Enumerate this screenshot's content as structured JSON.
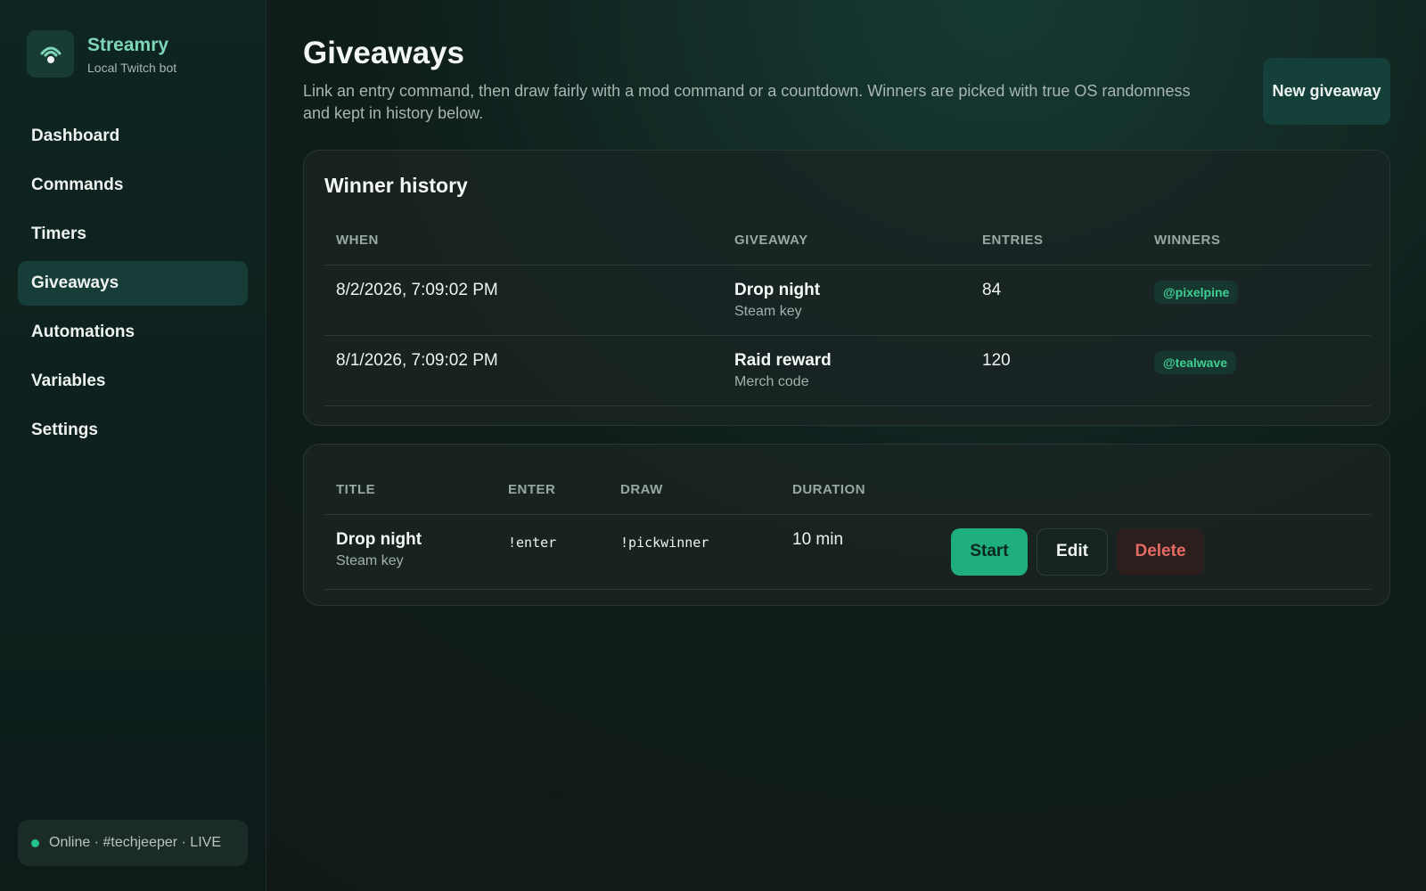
{
  "brand": {
    "name": "Streamry",
    "subtitle": "Local Twitch bot",
    "logo_icon": "broadcast-icon"
  },
  "sidebar": {
    "items": [
      {
        "label": "Dashboard",
        "active": false
      },
      {
        "label": "Commands",
        "active": false
      },
      {
        "label": "Timers",
        "active": false
      },
      {
        "label": "Giveaways",
        "active": true
      },
      {
        "label": "Automations",
        "active": false
      },
      {
        "label": "Variables",
        "active": false
      },
      {
        "label": "Settings",
        "active": false
      }
    ],
    "status": "Online · #techjeeper · LIVE"
  },
  "page": {
    "title": "Giveaways",
    "description": "Link an entry command, then draw fairly with a mod command or a countdown. Winners are picked with true OS randomness and kept in history below.",
    "new_button": "New giveaway"
  },
  "history": {
    "title": "Winner history",
    "columns": [
      "WHEN",
      "GIVEAWAY",
      "ENTRIES",
      "WINNERS"
    ],
    "rows": [
      {
        "when": "8/2/2026, 7:09:02 PM",
        "title": "Drop night",
        "prize": "Steam key",
        "entries": "84",
        "winner": "@pixelpine"
      },
      {
        "when": "8/1/2026, 7:09:02 PM",
        "title": "Raid reward",
        "prize": "Merch code",
        "entries": "120",
        "winner": "@tealwave"
      }
    ]
  },
  "giveaways": {
    "columns": [
      "TITLE",
      "ENTER",
      "DRAW",
      "DURATION"
    ],
    "rows": [
      {
        "title": "Drop night",
        "prize": "Steam key",
        "enter": "!enter",
        "draw": "!pickwinner",
        "duration": "10 min",
        "actions": {
          "start": "Start",
          "edit": "Edit",
          "delete": "Delete"
        }
      }
    ]
  },
  "colors": {
    "accent": "#1fae7d",
    "brand": "#7fd6b8",
    "danger": "#e36b63",
    "online": "#22c38a"
  }
}
